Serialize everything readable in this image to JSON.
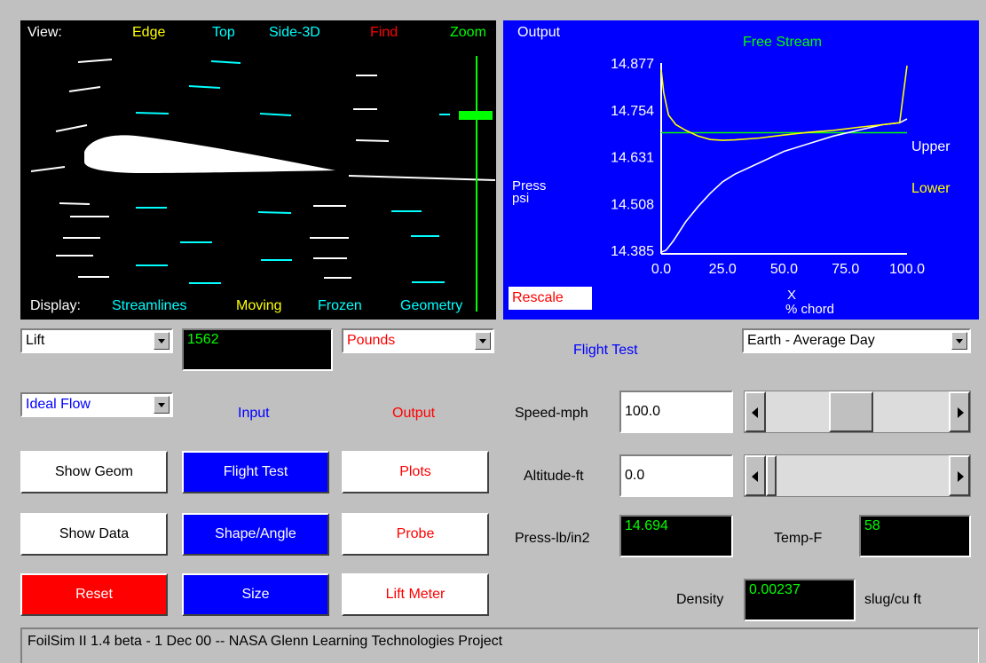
{
  "view_panel": {
    "view_label": "View:",
    "view_options": [
      "Edge",
      "Top",
      "Side-3D",
      "Find",
      "Zoom"
    ],
    "view_colors": [
      "#ffff00",
      "#00ffff",
      "#00ffff",
      "#ff0000",
      "#00ff00"
    ],
    "display_label": "Display:",
    "display_options": [
      "Streamlines",
      "Moving",
      "Frozen",
      "Geometry"
    ],
    "display_colors": [
      "#00ffff",
      "#ffff00",
      "#00ffff",
      "#00ffff"
    ]
  },
  "output_panel": {
    "title": "Output",
    "subtitle": "Free Stream",
    "rescale_label": "Rescale",
    "legend_upper": "Upper",
    "legend_lower": "Lower",
    "ylabel_line1": "Press",
    "ylabel_line2": "psi",
    "xlabel_line1": "X",
    "xlabel_line2": "% chord"
  },
  "chart_data": {
    "type": "line",
    "ylabel": "Press psi",
    "xlabel": "X % chord",
    "xlim": [
      0,
      100
    ],
    "ylim": [
      14.385,
      14.877
    ],
    "x_ticks": [
      "0.0",
      "25.0",
      "50.0",
      "75.0",
      "100.0"
    ],
    "y_ticks": [
      "14.877",
      "14.754",
      "14.631",
      "14.508",
      "14.385"
    ],
    "series": [
      {
        "name": "Free Stream",
        "color": "#00ff00",
        "x": [
          0,
          100
        ],
        "y": [
          14.694,
          14.694
        ]
      },
      {
        "name": "Upper",
        "color": "#ffffff",
        "x": [
          0,
          2,
          5,
          10,
          15,
          20,
          25,
          30,
          40,
          50,
          60,
          70,
          80,
          90,
          97,
          100
        ],
        "y": [
          14.38,
          14.385,
          14.41,
          14.46,
          14.5,
          14.535,
          14.565,
          14.585,
          14.615,
          14.645,
          14.665,
          14.685,
          14.7,
          14.715,
          14.72,
          14.73
        ]
      },
      {
        "name": "Lower",
        "color": "#ffff00",
        "x": [
          0,
          1,
          3,
          6,
          10,
          15,
          20,
          25,
          30,
          40,
          50,
          60,
          70,
          80,
          90,
          97,
          100
        ],
        "y": [
          14.86,
          14.8,
          14.74,
          14.715,
          14.7,
          14.685,
          14.676,
          14.674,
          14.675,
          14.68,
          14.688,
          14.695,
          14.7,
          14.708,
          14.715,
          14.72,
          14.87
        ]
      }
    ]
  },
  "controls": {
    "output_select": "Lift",
    "output_value": "1562",
    "units_select": "Pounds",
    "flow_select": "Ideal Flow",
    "input_label": "Input",
    "output_label": "Output",
    "show_geom": "Show Geom",
    "show_data": "Show Data",
    "reset": "Reset",
    "flight_test_btn": "Flight Test",
    "shape_angle": "Shape/Angle",
    "size": "Size",
    "plots": "Plots",
    "probe": "Probe",
    "lift_meter": "Lift Meter"
  },
  "flight": {
    "title": "Flight Test",
    "planet_select": "Earth - Average Day",
    "speed_label": "Speed-mph",
    "speed_value": "100.0",
    "speed_fraction": 0.45,
    "altitude_label": "Altitude-ft",
    "altitude_value": "0.0",
    "altitude_fraction": 0.0,
    "press_label": "Press-lb/in2",
    "press_value": "14.694",
    "temp_label": "Temp-F",
    "temp_value": "58",
    "density_label": "Density",
    "density_value": "0.00237",
    "density_units": "slug/cu ft"
  },
  "status_bar": {
    "text": "FoilSim II 1.4 beta - 1 Dec 00  --  NASA Glenn  Learning Technologies Project"
  }
}
